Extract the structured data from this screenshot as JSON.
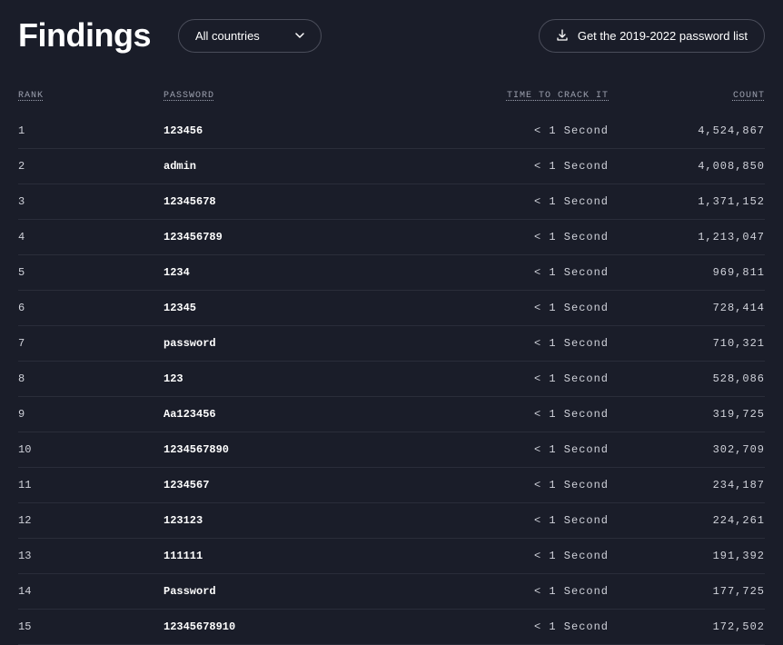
{
  "header": {
    "title": "Findings",
    "dropdown_label": "All countries",
    "cta_label": "Get the 2019-2022 password list"
  },
  "table": {
    "headers": {
      "rank": "RANK",
      "password": "PASSWORD",
      "time": "TIME TO CRACK IT",
      "count": "COUNT"
    },
    "rows": [
      {
        "rank": "1",
        "password": "123456",
        "time": "< 1 Second",
        "count": "4,524,867"
      },
      {
        "rank": "2",
        "password": "admin",
        "time": "< 1 Second",
        "count": "4,008,850"
      },
      {
        "rank": "3",
        "password": "12345678",
        "time": "< 1 Second",
        "count": "1,371,152"
      },
      {
        "rank": "4",
        "password": "123456789",
        "time": "< 1 Second",
        "count": "1,213,047"
      },
      {
        "rank": "5",
        "password": "1234",
        "time": "< 1 Second",
        "count": "969,811"
      },
      {
        "rank": "6",
        "password": "12345",
        "time": "< 1 Second",
        "count": "728,414"
      },
      {
        "rank": "7",
        "password": "password",
        "time": "< 1 Second",
        "count": "710,321"
      },
      {
        "rank": "8",
        "password": "123",
        "time": "< 1 Second",
        "count": "528,086"
      },
      {
        "rank": "9",
        "password": "Aa123456",
        "time": "< 1 Second",
        "count": "319,725"
      },
      {
        "rank": "10",
        "password": "1234567890",
        "time": "< 1 Second",
        "count": "302,709"
      },
      {
        "rank": "11",
        "password": "1234567",
        "time": "< 1 Second",
        "count": "234,187"
      },
      {
        "rank": "12",
        "password": "123123",
        "time": "< 1 Second",
        "count": "224,261"
      },
      {
        "rank": "13",
        "password": "111111",
        "time": "< 1 Second",
        "count": "191,392"
      },
      {
        "rank": "14",
        "password": "Password",
        "time": "< 1 Second",
        "count": "177,725"
      },
      {
        "rank": "15",
        "password": "12345678910",
        "time": "< 1 Second",
        "count": "172,502"
      }
    ]
  }
}
